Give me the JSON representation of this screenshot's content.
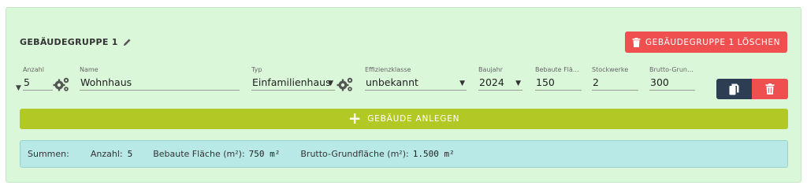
{
  "group": {
    "title": "GEBÄUDEGRUPPE 1",
    "edit_icon": "pencil-icon",
    "delete_label": "GEBÄUDEGRUPPE 1 LÖSCHEN"
  },
  "building": {
    "anzahl": {
      "label": "Anzahl",
      "value": "5"
    },
    "name": {
      "label": "Name",
      "value": "Wohnhaus"
    },
    "typ": {
      "label": "Typ",
      "value": "Einfamilienhaus"
    },
    "effizienzklasse": {
      "label": "Effizienzklasse",
      "value": "unbekannt"
    },
    "baujahr": {
      "label": "Baujahr",
      "value": "2024"
    },
    "bebaute_flaeche": {
      "label": "Bebaute Flä…",
      "value": "150"
    },
    "stockwerke": {
      "label": "Stockwerke",
      "value": "2"
    },
    "brutto_grundflaeche": {
      "label": "Brutto-Grun…",
      "value": "300"
    }
  },
  "add_building_label": "GEBÄUDE ANLEGEN",
  "summary": {
    "label": "Summen:",
    "anzahl_label": "Anzahl:",
    "anzahl_value": "5",
    "bebaute_label": "Bebaute Fläche (m²):",
    "bebaute_value": "750 m²",
    "brutto_label": "Brutto-Grundfläche (m²):",
    "brutto_value": "1.500 m²"
  },
  "colors": {
    "panel_bg": "#daf7d9",
    "danger": "#ef4f4f",
    "add_button": "#b2c925",
    "copy_button": "#2d3e54",
    "summary_bg": "#b9e9e6"
  }
}
